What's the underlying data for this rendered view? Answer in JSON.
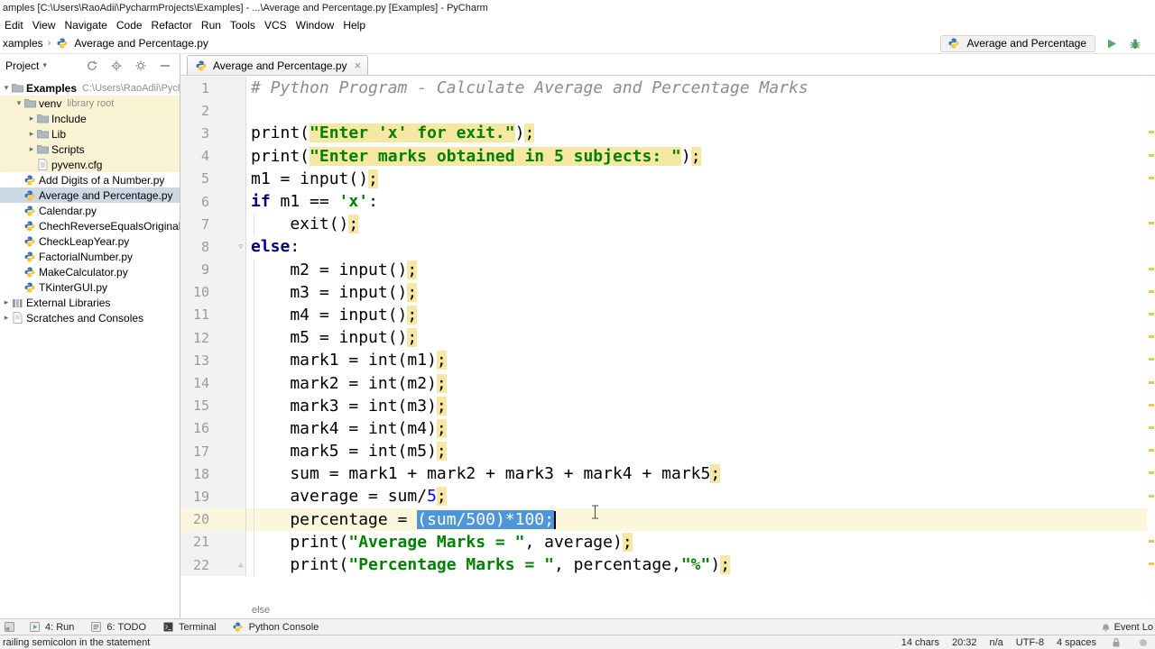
{
  "title_bar": {
    "title": "amples [C:\\Users\\RaoAdii\\PycharmProjects\\Examples] - ...\\Average and Percentage.py [Examples] - PyCharm"
  },
  "menu": {
    "items": [
      "Edit",
      "View",
      "Navigate",
      "Code",
      "Refactor",
      "Run",
      "Tools",
      "VCS",
      "Window",
      "Help"
    ]
  },
  "nav": {
    "root": "xamples",
    "file": "Average and Percentage.py",
    "run_config": "Average and Percentage"
  },
  "project": {
    "title": "Project",
    "items": [
      {
        "label": "Examples",
        "sub": "C:\\Users\\RaoAdii\\PycharmP",
        "depth": 0,
        "icon": "folder",
        "arrow": "down",
        "bold": true
      },
      {
        "label": "venv",
        "sub": "library root",
        "depth": 1,
        "icon": "folder",
        "arrow": "down",
        "lib": true
      },
      {
        "label": "Include",
        "depth": 2,
        "icon": "folder",
        "arrow": "right",
        "lib": true
      },
      {
        "label": "Lib",
        "depth": 2,
        "icon": "folder",
        "arrow": "right",
        "lib": true
      },
      {
        "label": "Scripts",
        "depth": 2,
        "icon": "folder",
        "arrow": "right",
        "lib": true
      },
      {
        "label": "pyvenv.cfg",
        "depth": 2,
        "icon": "file",
        "lib": true
      },
      {
        "label": "Add Digits of a Number.py",
        "depth": 1,
        "icon": "python"
      },
      {
        "label": "Average and Percentage.py",
        "depth": 1,
        "icon": "python",
        "selected": true
      },
      {
        "label": "Calendar.py",
        "depth": 1,
        "icon": "python"
      },
      {
        "label": "ChechReverseEqualsOriginal.py",
        "depth": 1,
        "icon": "python"
      },
      {
        "label": "CheckLeapYear.py",
        "depth": 1,
        "icon": "python"
      },
      {
        "label": "FactorialNumber.py",
        "depth": 1,
        "icon": "python"
      },
      {
        "label": "MakeCalculator.py",
        "depth": 1,
        "icon": "python"
      },
      {
        "label": "TKinterGUI.py",
        "depth": 1,
        "icon": "python"
      },
      {
        "label": "External Libraries",
        "depth": 0,
        "icon": "lib",
        "arrow": "right"
      },
      {
        "label": "Scratches and Consoles",
        "depth": 0,
        "icon": "scratch",
        "arrow": "right"
      }
    ]
  },
  "editor": {
    "tab_title": "Average and Percentage.py",
    "breadcrumb": "else",
    "lines": [
      {
        "n": 1,
        "segs": [
          {
            "t": "# Python Program - Calculate Average and Percentage Marks",
            "c": "com"
          }
        ]
      },
      {
        "n": 2,
        "segs": []
      },
      {
        "n": 3,
        "segs": [
          {
            "t": "print("
          },
          {
            "t": "\"Enter 'x' for exit.\"",
            "c": "str",
            "w": true
          },
          {
            "t": ")"
          },
          {
            "t": ";",
            "w": true
          }
        ]
      },
      {
        "n": 4,
        "segs": [
          {
            "t": "print("
          },
          {
            "t": "\"Enter marks obtained in 5 subjects: \"",
            "c": "str",
            "w": true
          },
          {
            "t": ")"
          },
          {
            "t": ";",
            "w": true
          }
        ]
      },
      {
        "n": 5,
        "segs": [
          {
            "t": "m1 = input()"
          },
          {
            "t": ";",
            "w": true
          }
        ]
      },
      {
        "n": 6,
        "segs": [
          {
            "t": "if",
            "c": "kw"
          },
          {
            "t": " m1 == "
          },
          {
            "t": "'x'",
            "c": "str"
          },
          {
            "t": ":"
          }
        ]
      },
      {
        "n": 7,
        "segs": [
          {
            "t": "    exit()"
          },
          {
            "t": ";",
            "w": true
          }
        ]
      },
      {
        "n": 8,
        "fold": "down",
        "segs": [
          {
            "t": "else",
            "c": "kw"
          },
          {
            "t": ":"
          }
        ]
      },
      {
        "n": 9,
        "segs": [
          {
            "t": "    m2 = input()"
          },
          {
            "t": ";",
            "w": true
          }
        ]
      },
      {
        "n": 10,
        "segs": [
          {
            "t": "    m3 = input()"
          },
          {
            "t": ";",
            "w": true
          }
        ]
      },
      {
        "n": 11,
        "segs": [
          {
            "t": "    m4 = input()"
          },
          {
            "t": ";",
            "w": true
          }
        ]
      },
      {
        "n": 12,
        "segs": [
          {
            "t": "    m5 = input()"
          },
          {
            "t": ";",
            "w": true
          }
        ]
      },
      {
        "n": 13,
        "segs": [
          {
            "t": "    mark1 = int(m1)"
          },
          {
            "t": ";",
            "w": true
          }
        ]
      },
      {
        "n": 14,
        "segs": [
          {
            "t": "    mark2 = int(m2)"
          },
          {
            "t": ";",
            "w": true
          }
        ]
      },
      {
        "n": 15,
        "segs": [
          {
            "t": "    mark3 = int(m3)"
          },
          {
            "t": ";",
            "w": true
          }
        ]
      },
      {
        "n": 16,
        "segs": [
          {
            "t": "    mark4 = int(m4)"
          },
          {
            "t": ";",
            "w": true
          }
        ]
      },
      {
        "n": 17,
        "segs": [
          {
            "t": "    mark5 = int(m5)"
          },
          {
            "t": ";",
            "w": true
          }
        ]
      },
      {
        "n": 18,
        "segs": [
          {
            "t": "    sum = mark1 + mark2 + mark3 + mark4 + mark5"
          },
          {
            "t": ";",
            "w": true
          }
        ]
      },
      {
        "n": 19,
        "segs": [
          {
            "t": "    average = sum/"
          },
          {
            "t": "5",
            "c": "num"
          },
          {
            "t": ";",
            "w": true
          }
        ]
      },
      {
        "n": 20,
        "cur": true,
        "caret": true,
        "segs": [
          {
            "t": "    percentage = "
          },
          {
            "t": "(sum/",
            "s": true
          },
          {
            "t": "500",
            "c": "num",
            "s": true
          },
          {
            "t": ")*",
            "s": true
          },
          {
            "t": "100",
            "c": "num",
            "s": true
          },
          {
            "t": ";",
            "s": true
          }
        ]
      },
      {
        "n": 21,
        "segs": [
          {
            "t": "    print("
          },
          {
            "t": "\"Average Marks = \"",
            "c": "str"
          },
          {
            "t": ", average)"
          },
          {
            "t": ";",
            "w": true
          }
        ]
      },
      {
        "n": 22,
        "fold": "up",
        "segs": [
          {
            "t": "    print("
          },
          {
            "t": "\"Percentage Marks = \"",
            "c": "str"
          },
          {
            "t": ", percentage,"
          },
          {
            "t": "\"%\"",
            "c": "str"
          },
          {
            "t": ")"
          },
          {
            "t": ";",
            "w": true
          }
        ]
      }
    ]
  },
  "tool_bar": {
    "left": [
      {
        "label": "4: Run",
        "icon": "run",
        "name": "toolwindow-run"
      },
      {
        "label": "6: TODO",
        "icon": "todo",
        "name": "toolwindow-todo"
      },
      {
        "label": "Terminal",
        "icon": "terminal",
        "name": "toolwindow-terminal"
      },
      {
        "label": "Python Console",
        "icon": "pyconsole",
        "name": "toolwindow-python-console"
      }
    ],
    "right_label": "Event Lo"
  },
  "status": {
    "message": "railing semicolon in the statement",
    "items": [
      {
        "label": "14 chars",
        "name": "selection-size"
      },
      {
        "label": "20:32",
        "name": "caret-position"
      },
      {
        "label": "n/a",
        "name": "line-separator"
      },
      {
        "label": "UTF-8",
        "name": "file-encoding"
      },
      {
        "label": "4 spaces",
        "name": "indent-size"
      }
    ]
  },
  "colors": {
    "run_green": "#59A869",
    "selection_blue": "#4E96D8",
    "warning_yellow": "#F6E8A4",
    "current_line": "#FBF6DC",
    "library_row": "#FAF3D3",
    "selected_row": "#CCD9E5"
  }
}
